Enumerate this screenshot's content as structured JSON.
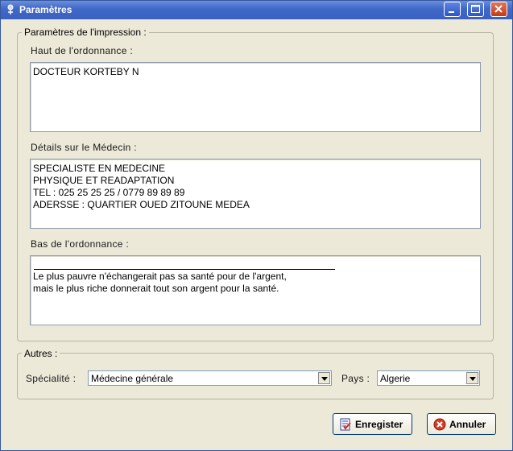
{
  "window": {
    "title": "Paramètres"
  },
  "print_group": {
    "title": "Paramètres de l'impression :",
    "haut": {
      "label": "Haut de l'ordonnance :",
      "line1": "DOCTEUR KORTEBY N"
    },
    "details": {
      "label": "Détails sur le Médecin :",
      "line1": "SPECIALISTE EN MEDECINE",
      "line2": "PHYSIQUE ET READAPTATION",
      "line3": "TEL : 025 25 25 25 / 0779 89 89 89",
      "line4": "ADERSSE : QUARTIER OUED ZITOUNE MEDEA"
    },
    "bas": {
      "label": "Bas de l'ordonnance :",
      "line1": "Le plus pauvre n'échangerait pas sa santé pour de l'argent,",
      "line2": "mais le plus riche donnerait tout son argent pour la santé."
    }
  },
  "autres_group": {
    "title": "Autres :",
    "specialite": {
      "label": "Spécialité :",
      "value": "Médecine générale"
    },
    "pays": {
      "label": "Pays :",
      "value": "Algerie"
    }
  },
  "buttons": {
    "save": "Enregister",
    "cancel": "Annuler"
  },
  "colors": {
    "titlebar": "#3a60c0",
    "dialog_bg": "#ece9d8",
    "close_red": "#c23a18"
  },
  "icons": {
    "app": "app-icon",
    "save": "save-icon",
    "cancel": "cancel-icon"
  }
}
